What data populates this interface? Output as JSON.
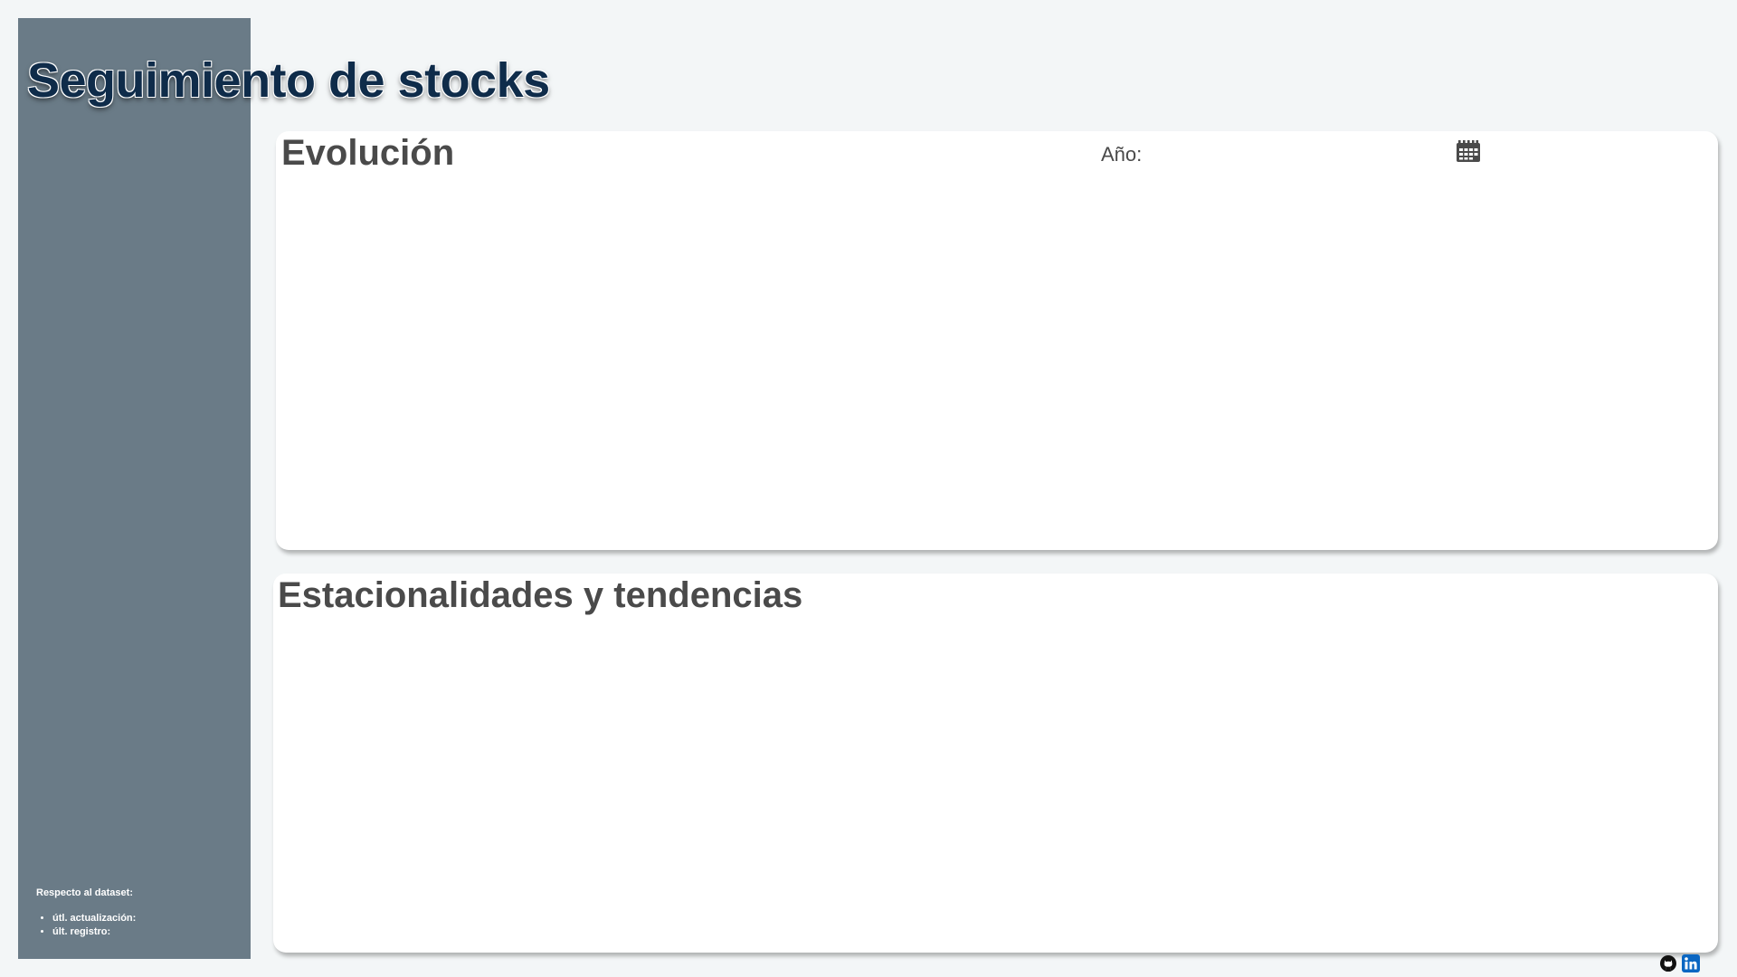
{
  "header": {
    "title": "Seguimiento de stocks"
  },
  "sidebar": {
    "dataset_heading": "Respecto al dataset:",
    "dataset_items": [
      {
        "label": "útl. actualización:"
      },
      {
        "label": "últ. registro:"
      }
    ]
  },
  "evolucion": {
    "title": "Evolución",
    "year_label": "Año:",
    "year_value": "",
    "year_icon": "calendar-icon"
  },
  "estacionalidades": {
    "title": "Estacionalidades y tendencias"
  },
  "footer": {
    "icons": [
      "github-icon",
      "linkedin-icon"
    ]
  },
  "colors": {
    "background": "#f3f6f7",
    "sidebar": "#6a7b87",
    "title": "#0f2c4a",
    "card": "#ffffff",
    "card_heading": "#4a4a4a",
    "linkedin": "#0a66c2"
  }
}
